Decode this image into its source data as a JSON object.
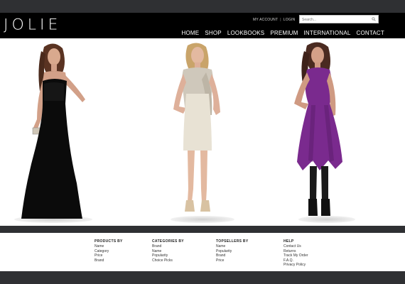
{
  "brand": {
    "logo": "JOLIE"
  },
  "utility": {
    "my_account": "MY ACCOUNT",
    "separator": "|",
    "login": "LOGIN"
  },
  "search": {
    "placeholder": "Search...",
    "icon": "search-icon"
  },
  "nav": [
    "HOME",
    "SHOP",
    "LOOKBOOKS",
    "PREMIUM",
    "INTERNATIONAL",
    "CONTACT"
  ],
  "hero": {
    "models": [
      {
        "outfit": "black strapless gown"
      },
      {
        "outfit": "ivory shift dress with scarf"
      },
      {
        "outfit": "purple ruffled dress"
      }
    ]
  },
  "footer": {
    "columns": [
      {
        "heading": "PRODUCTS BY",
        "links": [
          "Name",
          "Category",
          "Price",
          "Brand"
        ]
      },
      {
        "heading": "CATEGORIES BY",
        "links": [
          "Brand",
          "Name",
          "Popularity",
          "Choice Picks"
        ]
      },
      {
        "heading": "TOPSELLERS BY",
        "links": [
          "Name",
          "Popularity",
          "Brand",
          "Price"
        ]
      },
      {
        "heading": "HELP",
        "links": [
          "Contact Us",
          "Returns",
          "Track My Order",
          "F.A.Q.",
          "Privacy Policy"
        ]
      }
    ]
  },
  "colors": {
    "header_bg": "#000000",
    "outer_bg": "#2f3033",
    "gown": "#0b0b0b",
    "dress_ivory": "#e8e2d4",
    "dress_purple": "#7a2a8e"
  }
}
